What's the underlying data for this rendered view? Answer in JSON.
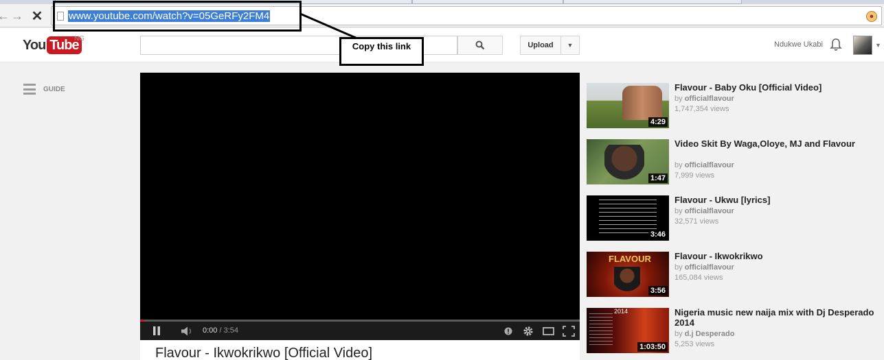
{
  "browser": {
    "url": "www.youtube.com/watch?v=05GeRFy2FM4",
    "back_icon": "back-arrow-icon",
    "forward_icon": "forward-arrow-icon",
    "stop_icon": "stop-loading-icon"
  },
  "annotation": {
    "label": "Copy this link"
  },
  "masthead": {
    "logo_you": "You",
    "logo_tube": "Tube",
    "region": "NG",
    "search_placeholder": "",
    "upload_label": "Upload",
    "username": "Ndukwe Ukabi"
  },
  "guide": {
    "label": "GUIDE"
  },
  "player": {
    "current_time": "0:00",
    "separator": " / ",
    "duration": "3:54",
    "progress_fraction": 0.01
  },
  "video": {
    "title": "Flavour - Ikwokrikwo [Official Video]"
  },
  "sidebar": {
    "items": [
      {
        "title": "Flavour - Baby Oku [Official Video]",
        "by_prefix": "by ",
        "channel": "officialflavour",
        "views": "1,747,354 views",
        "duration": "4:29"
      },
      {
        "title": "Video Skit By Waga,Oloye, MJ and Flavour",
        "by_prefix": "by ",
        "channel": "officialflavour",
        "views": "7,999 views",
        "duration": "1:47"
      },
      {
        "title": "Flavour - Ukwu [lyrics]",
        "by_prefix": "by ",
        "channel": "officialflavour",
        "views": "32,571 views",
        "duration": "3:46"
      },
      {
        "title": "Flavour - Ikwokrikwo",
        "by_prefix": "by ",
        "channel": "officialflavour",
        "views": "165,084 views",
        "duration": "3:56"
      },
      {
        "title": "Nigeria music new naija mix with Dj Desperado 2014",
        "by_prefix": "by ",
        "channel": "d.j Desperado",
        "views": "5,253 views",
        "duration": "1:03:50"
      }
    ],
    "thumb3_text": "FLAVOUR",
    "thumb4_text": "2014"
  },
  "colors": {
    "url_selection": "#3d7fd8",
    "youtube_red": "#cc181e",
    "player_bg": "#000000"
  }
}
